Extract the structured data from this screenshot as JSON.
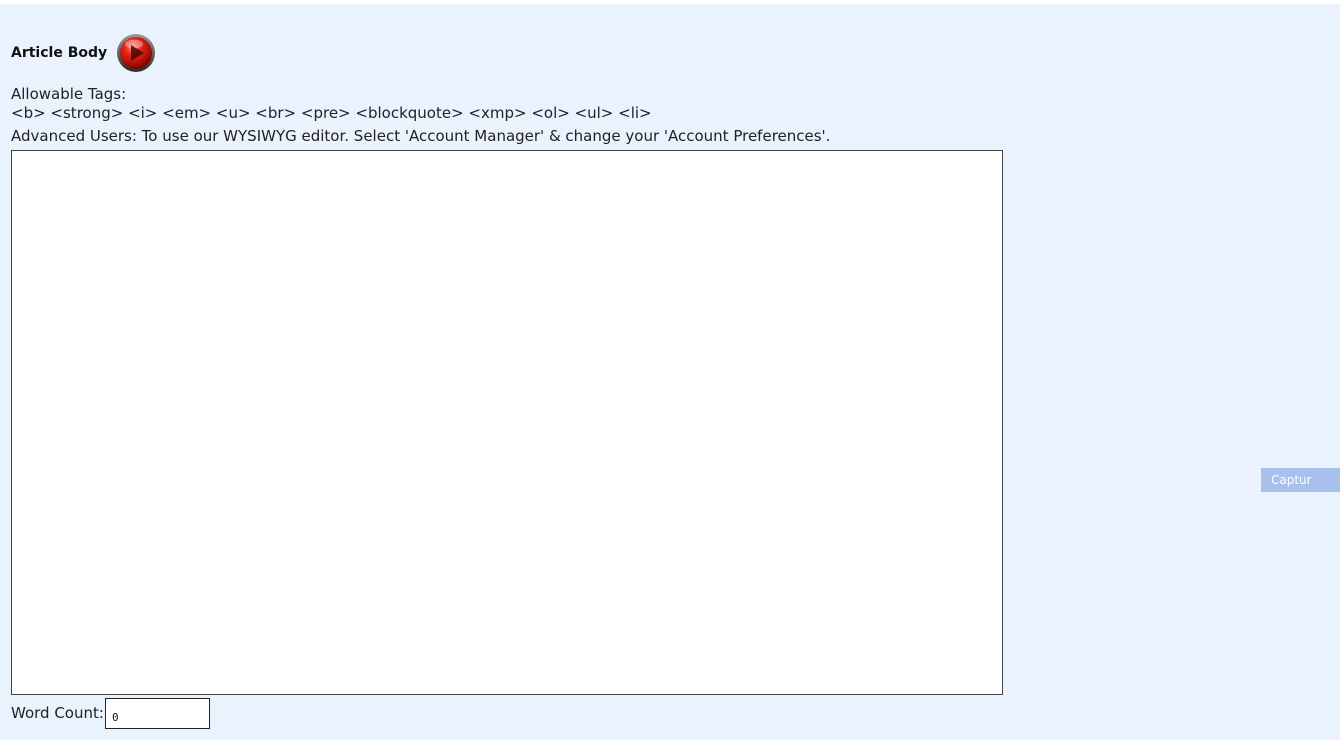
{
  "article": {
    "heading": "Article Body",
    "play_icon": "play-circle-icon",
    "allowable_tags_label": "Allowable Tags:",
    "allowable_tags": "<b> <strong> <i> <em> <u> <br> <pre> <blockquote> <xmp> <ol> <ul> <li>",
    "advanced_note": "Advanced Users: To use our WYSIWYG editor. Select 'Account Manager' & change your 'Account Preferences'.",
    "editor_value": "",
    "word_count_label": "Word Count:",
    "word_count_value": "0"
  },
  "side": {
    "capture_label": "Captur"
  },
  "colors": {
    "panel_background": "#eaf2fd",
    "capture_button": "#a8c0ec",
    "play_icon_red": "#d81c10"
  }
}
